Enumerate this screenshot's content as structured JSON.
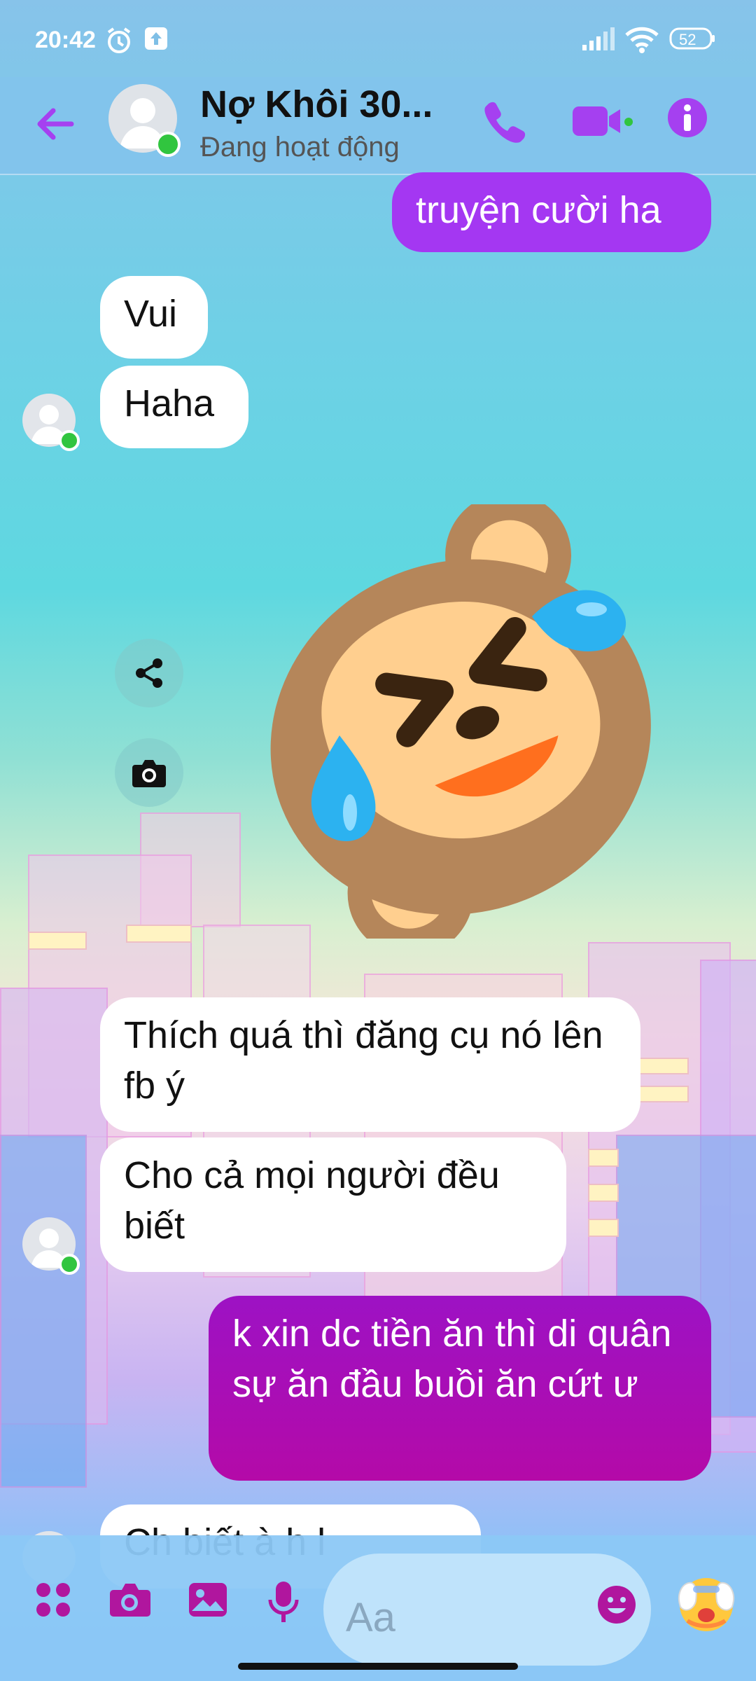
{
  "status_bar": {
    "time": "20:42",
    "battery": "52"
  },
  "header": {
    "contact_name": "Nợ Khôi 30...",
    "presence": "Đang hoạt động"
  },
  "messages": [
    {
      "side": "out",
      "text": "truyện cười ha"
    },
    {
      "side": "in",
      "text": "Vui"
    },
    {
      "side": "in",
      "text": "Haha"
    },
    {
      "side": "in",
      "type": "sticker",
      "sticker": "laughing-monkey-sticker"
    },
    {
      "side": "in",
      "text": "Thích quá thì đăng cụ nó lên fb ý"
    },
    {
      "side": "in",
      "text": "Cho cả mọi người đều biết"
    },
    {
      "side": "out",
      "text": "k xin dc tiền ăn thì di quân sự ăn đầu buồi ăn cứt ư"
    },
    {
      "side": "in",
      "text": "Ch  biết  à  h  l"
    }
  ],
  "composer": {
    "placeholder": "Aa"
  },
  "colors": {
    "accent": "#a540f0",
    "outgoing_top": "#a437f2",
    "outgoing_bottom": "#b40aa8",
    "online": "#31c53f"
  },
  "icons": [
    "back-arrow-icon",
    "phone-icon",
    "video-call-icon",
    "info-icon",
    "share-icon",
    "camera-icon",
    "menu-dots-icon",
    "image-icon",
    "microphone-icon",
    "emoji-icon",
    "reaction-emoji-icon"
  ]
}
